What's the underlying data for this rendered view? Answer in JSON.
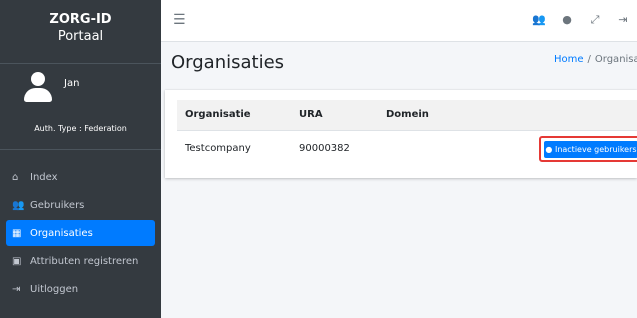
{
  "brand": {
    "line1": "ZORG-ID",
    "line2": "Portaal"
  },
  "user": {
    "name": "Jan",
    "auth_type": "Auth. Type : Federation"
  },
  "sidebar": {
    "items": [
      {
        "label": "Index",
        "icon": "home-icon",
        "glyph": "⌂"
      },
      {
        "label": "Gebruikers",
        "icon": "users-icon",
        "glyph": "👥"
      },
      {
        "label": "Organisaties",
        "icon": "building-icon",
        "glyph": "▦"
      },
      {
        "label": "Attributen registreren",
        "icon": "id-card-icon",
        "glyph": "▣"
      },
      {
        "label": "Uitloggen",
        "icon": "sign-out-icon",
        "glyph": "⇥"
      }
    ],
    "active_index": 2
  },
  "topbar": {
    "menu_icon": "☰",
    "icons": [
      {
        "name": "users-icon",
        "glyph": "👥"
      },
      {
        "name": "user-icon",
        "glyph": "●"
      },
      {
        "name": "expand-icon",
        "glyph": "⤢"
      },
      {
        "name": "logout-icon",
        "glyph": "⇥"
      }
    ]
  },
  "page": {
    "title": "Organisaties",
    "breadcrumb": {
      "home": "Home",
      "separator": "/",
      "current": "Organisaties"
    }
  },
  "table": {
    "headers": [
      "Organisatie",
      "URA",
      "Domein"
    ],
    "rows": [
      {
        "organisatie": "Testcompany",
        "ura": "90000382",
        "domein": "",
        "action_label": "Inactieve gebruikers"
      }
    ]
  },
  "colors": {
    "sidebar_bg": "#343a40",
    "accent": "#007bff",
    "highlight": "#e53935"
  }
}
